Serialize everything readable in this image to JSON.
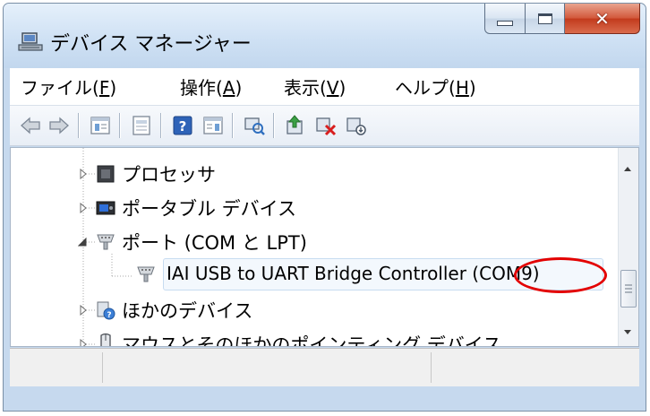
{
  "window": {
    "title": "デバイス マネージャー"
  },
  "menu": {
    "items": [
      {
        "label": "ファイル(",
        "accel": "F",
        "close": ")"
      },
      {
        "label": "操作(",
        "accel": "A",
        "close": ")"
      },
      {
        "label": "表示(",
        "accel": "V",
        "close": ")"
      },
      {
        "label": "ヘルプ(",
        "accel": "H",
        "close": ")"
      }
    ]
  },
  "toolbar": {
    "icons": [
      "back-arrow-icon",
      "forward-arrow-icon",
      "properties-icon",
      "print-icon",
      "help-icon",
      "console-tree-icon",
      "scan-hardware-icon",
      "update-driver-icon",
      "uninstall-icon",
      "disable-icon"
    ]
  },
  "tree": {
    "items": [
      {
        "label": "プロセッサ",
        "icon": "processor-icon",
        "expanded": false
      },
      {
        "label": "ポータブル デバイス",
        "icon": "portable-device-icon",
        "expanded": false
      },
      {
        "label": "ポート (COM と LPT)",
        "icon": "port-icon",
        "expanded": true
      },
      {
        "label": "IAI USB to UART Bridge Controller (COM9)",
        "icon": "port-device-icon",
        "child": true,
        "selected": true
      },
      {
        "label": "ほかのデバイス",
        "icon": "unknown-device-icon",
        "expanded": false
      },
      {
        "label": "マウスとそのほかのポインティング デバイス",
        "icon": "mouse-icon",
        "expanded": false
      }
    ]
  },
  "colors": {
    "highlight": "#e30000",
    "frame": "#c6d9ee"
  }
}
